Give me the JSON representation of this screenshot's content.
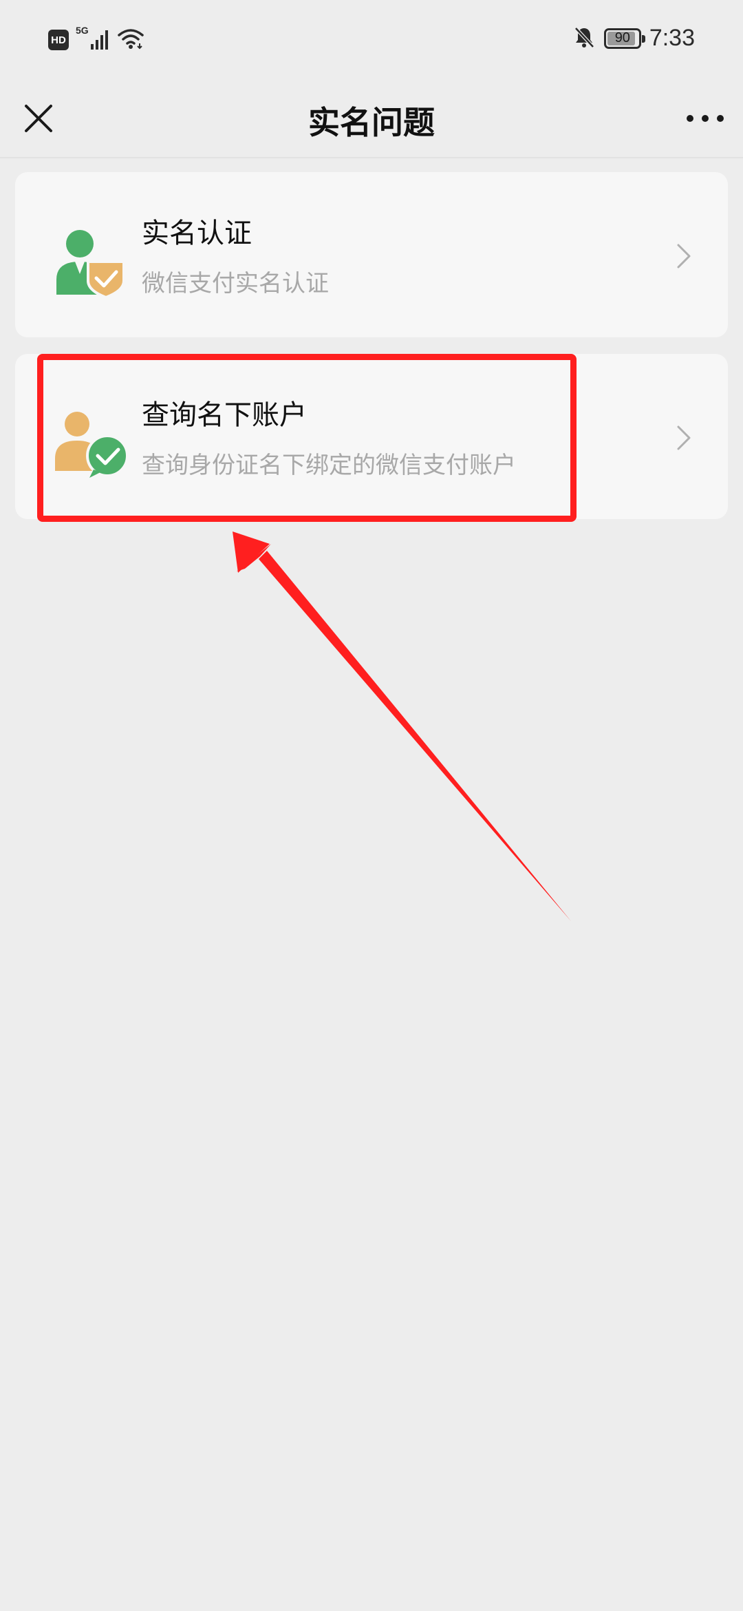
{
  "status_bar": {
    "hd_label": "HD",
    "network_label": "5G",
    "battery_level": "90",
    "time": "7:33"
  },
  "nav": {
    "title": "实名问题",
    "close_icon": "close-icon",
    "more_icon": "more-icon"
  },
  "cards": [
    {
      "title": "实名认证",
      "subtitle": "微信支付实名认证",
      "icon": "user-shield-icon",
      "icon_colors": {
        "person": "#4caf69",
        "badge": "#e9b56a"
      }
    },
    {
      "title": "查询名下账户",
      "subtitle": "查询身份证名下绑定的微信支付账户",
      "icon": "user-chat-check-icon",
      "icon_colors": {
        "person": "#e9b56a",
        "badge": "#4caf69"
      }
    }
  ],
  "annotation": {
    "color": "#ff1f1f",
    "highlight_target": "card-2"
  }
}
